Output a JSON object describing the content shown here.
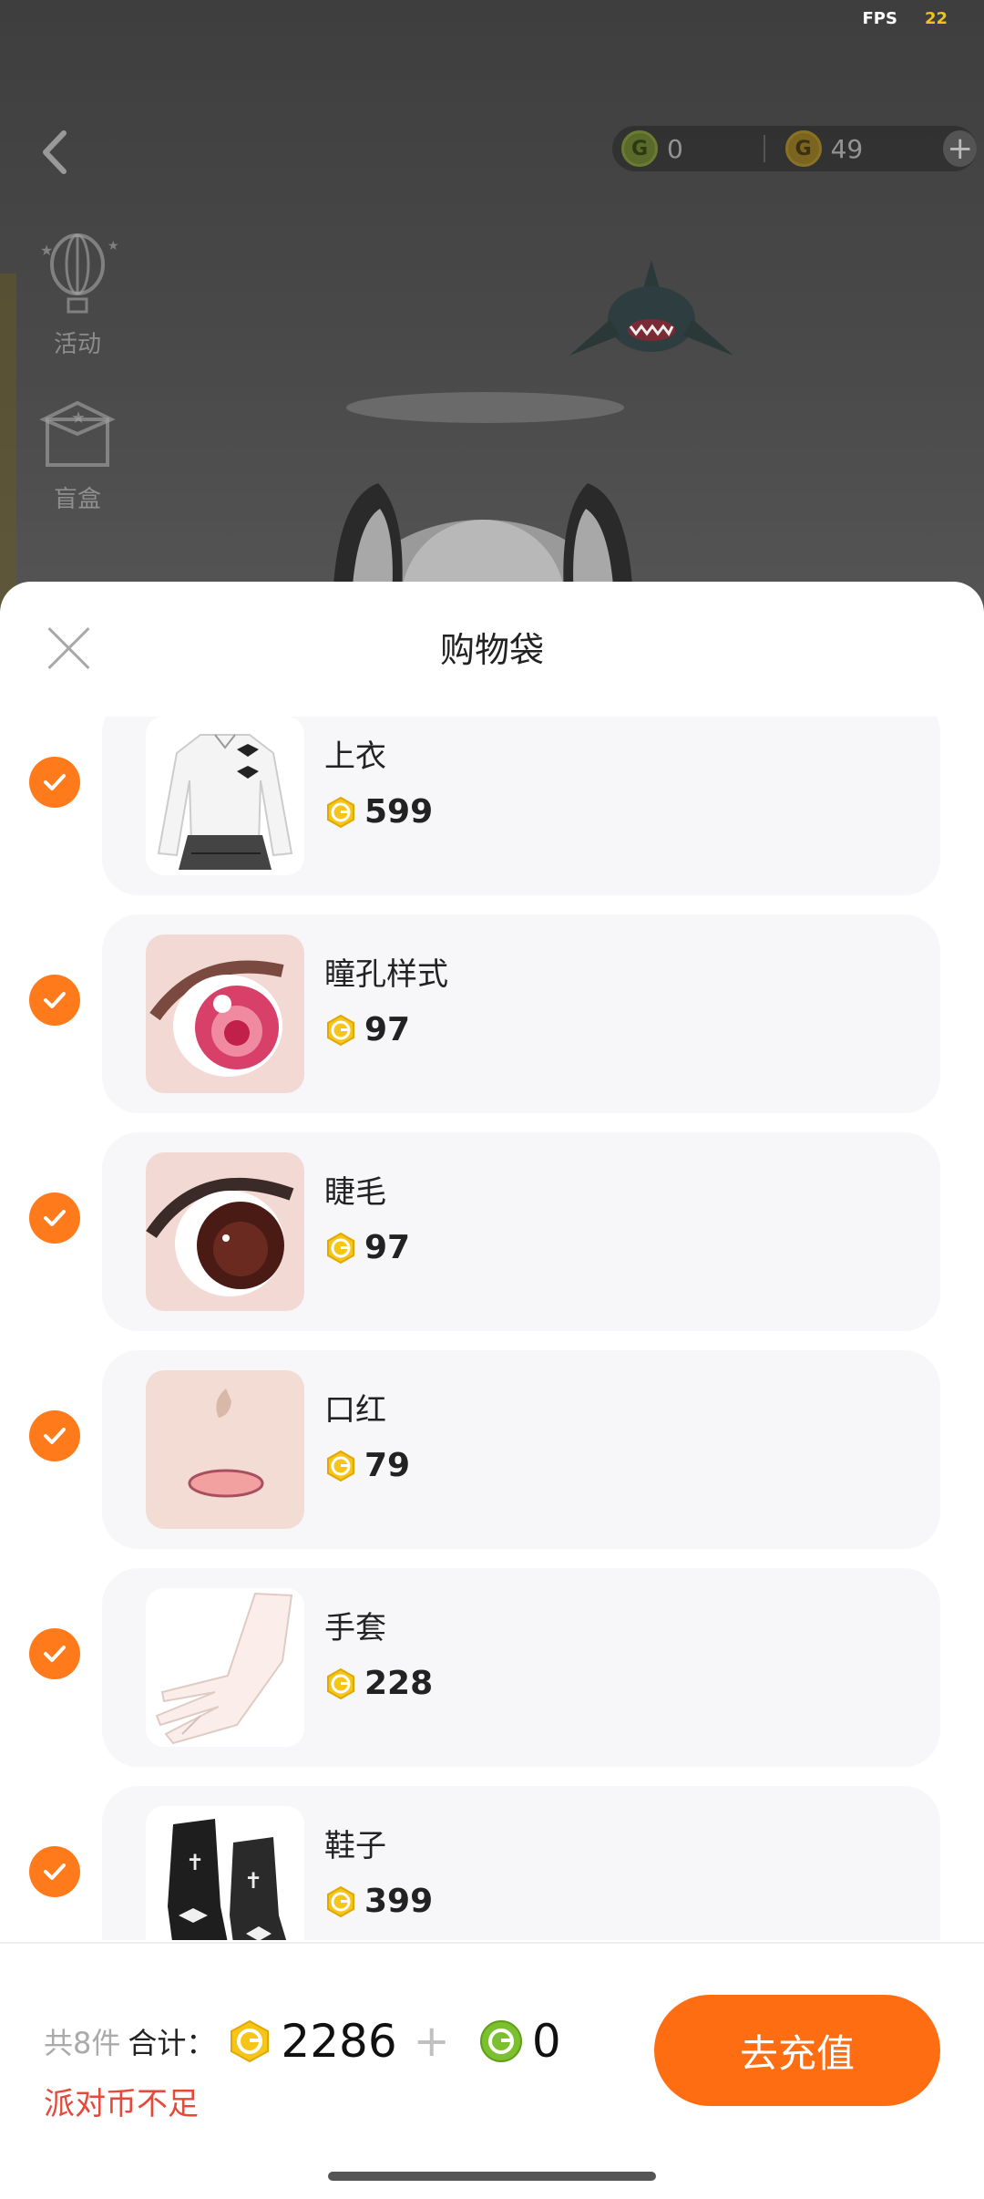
{
  "status": {
    "fps_label": "FPS",
    "fps_value": "22"
  },
  "top_bar": {
    "green_coin_amount": "0",
    "gold_coin_amount": "49",
    "coin_glyph": "G"
  },
  "side_menu": [
    {
      "label": "活动",
      "icon": "hot-air-balloon-icon"
    },
    {
      "label": "盲盒",
      "icon": "gift-box-icon"
    }
  ],
  "sheet": {
    "title": "购物袋",
    "items": [
      {
        "name": "上衣",
        "price": "599",
        "checked": true,
        "thumb": "white-blouse-with-black-bows"
      },
      {
        "name": "瞳孔样式",
        "price": "97",
        "checked": true,
        "thumb": "pink-eye"
      },
      {
        "name": "睫毛",
        "price": "97",
        "checked": true,
        "thumb": "brown-eye"
      },
      {
        "name": "口红",
        "price": "79",
        "checked": true,
        "thumb": "pink-lips"
      },
      {
        "name": "手套",
        "price": "228",
        "checked": true,
        "thumb": "white-glove"
      },
      {
        "name": "鞋子",
        "price": "399",
        "checked": true,
        "thumb": "black-boots"
      }
    ]
  },
  "footer": {
    "count_label": "共8件",
    "total_label": "合计：",
    "gold_total": "2286",
    "plus": "+",
    "green_total": "0",
    "warning": "派对币不足",
    "recharge_button": "去充值"
  },
  "colors": {
    "accent_orange": "#ff6d12",
    "check_orange": "#ff7a1a",
    "warning_red": "#e5493a",
    "gold_coin": "#f5c518",
    "green_coin": "#7dc02e"
  }
}
